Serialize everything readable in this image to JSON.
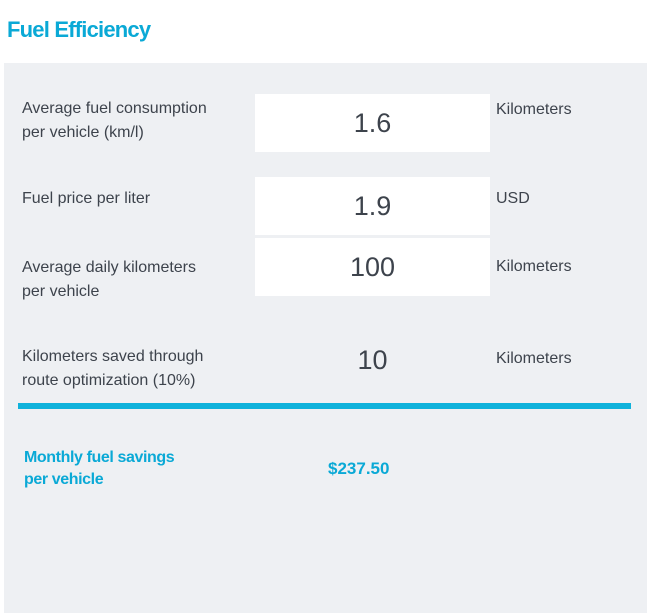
{
  "header": {
    "title": "Fuel Efficiency"
  },
  "rows": [
    {
      "label_line1": "Average fuel consumption",
      "label_line2": "per vehicle (km/l)",
      "value": "1.6",
      "unit": "Kilometers"
    },
    {
      "label_line1": "Fuel price per liter",
      "value": "1.9",
      "unit": "USD"
    },
    {
      "label_line1": "Average daily kilometers",
      "label_line2": "per vehicle",
      "value": "100",
      "unit": "Kilometers"
    },
    {
      "label_line1": "Kilometers saved through",
      "label_line2": "route optimization (10%)",
      "value": "10",
      "unit": "Kilometers"
    }
  ],
  "result": {
    "label_line1": "Monthly fuel savings",
    "label_line2": "per vehicle",
    "value": "$237.50"
  },
  "colors": {
    "accent": "#0aa9d6",
    "divider": "#0fb2db",
    "panel_background": "#eef0f3",
    "text": "#3d434c"
  }
}
